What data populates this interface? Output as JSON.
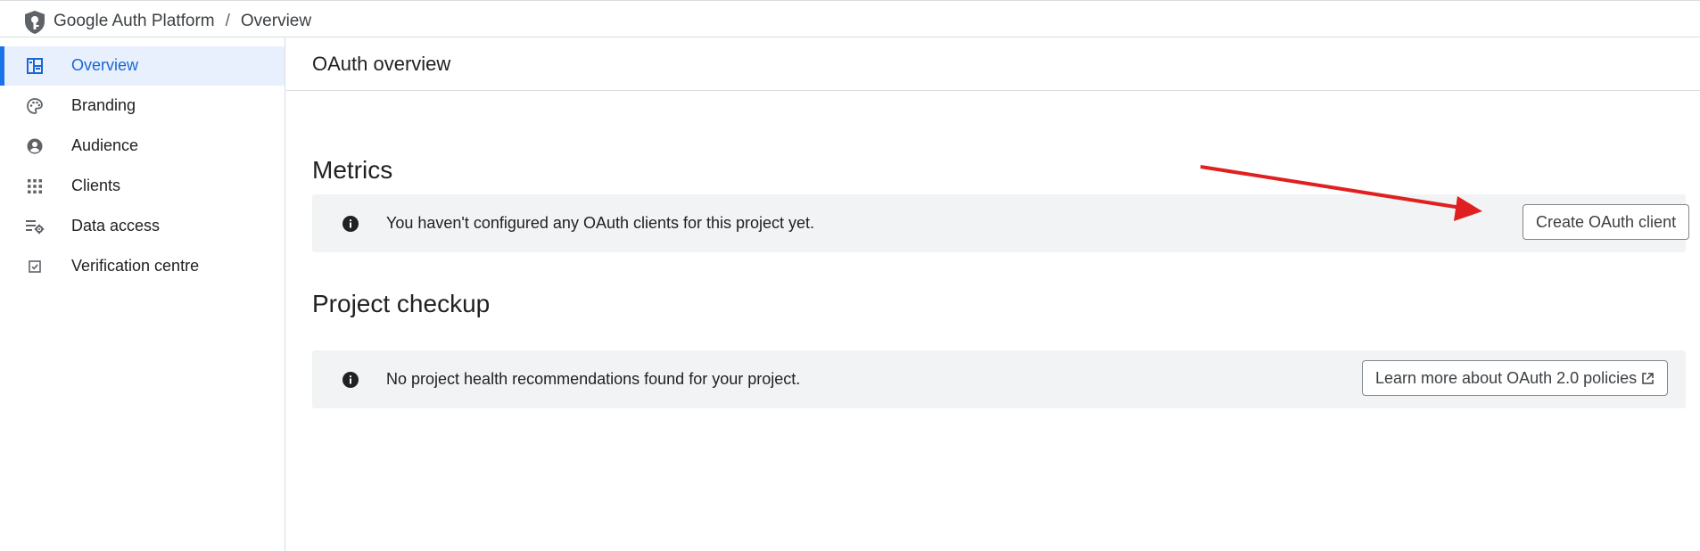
{
  "breadcrumb": {
    "app": "Google Auth Platform",
    "separator": "/",
    "current": "Overview"
  },
  "sidebar": {
    "items": [
      {
        "label": "Overview",
        "icon": "dashboard-icon",
        "active": true
      },
      {
        "label": "Branding",
        "icon": "palette-icon",
        "active": false
      },
      {
        "label": "Audience",
        "icon": "account-circle-icon",
        "active": false
      },
      {
        "label": "Clients",
        "icon": "apps-grid-icon",
        "active": false
      },
      {
        "label": "Data access",
        "icon": "data-settings-icon",
        "active": false
      },
      {
        "label": "Verification centre",
        "icon": "checkbox-icon",
        "active": false
      }
    ]
  },
  "main": {
    "page_title": "OAuth overview",
    "metrics": {
      "title": "Metrics",
      "message": "You haven't configured any OAuth clients for this project yet.",
      "button": "Create OAuth client"
    },
    "checkup": {
      "title": "Project checkup",
      "message": "No project health recommendations found for your project.",
      "button": "Learn more about OAuth 2.0 policies"
    }
  },
  "colors": {
    "accent": "#1a73e8",
    "active_bg": "#e8f0fe",
    "banner_bg": "#f1f3f4",
    "annotation_arrow": "#e02020"
  }
}
